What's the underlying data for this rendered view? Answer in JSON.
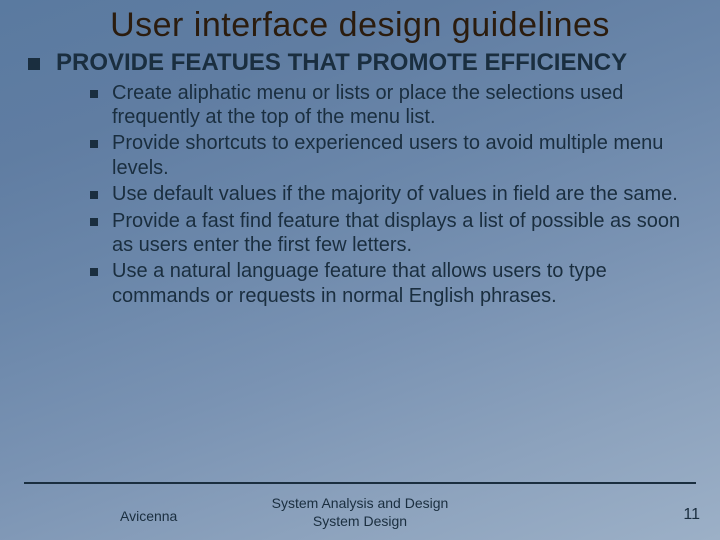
{
  "title": "User interface design guidelines",
  "heading": "PROVIDE FEATUES THAT PROMOTE EFFICIENCY",
  "bullets": [
    "Create aliphatic menu or lists or place the selections used frequently at the top of the menu list.",
    "Provide shortcuts to experienced users to avoid multiple menu levels.",
    "Use default values if the majority of values in field are the same.",
    "Provide a fast find feature that displays a list of possible as soon as users enter the first few letters.",
    "Use a natural language feature that allows users to type commands or requests in normal English phrases."
  ],
  "footer": {
    "left": "Avicenna",
    "center_line1": "System Analysis and Design",
    "center_line2": "System Design",
    "page": "11"
  }
}
